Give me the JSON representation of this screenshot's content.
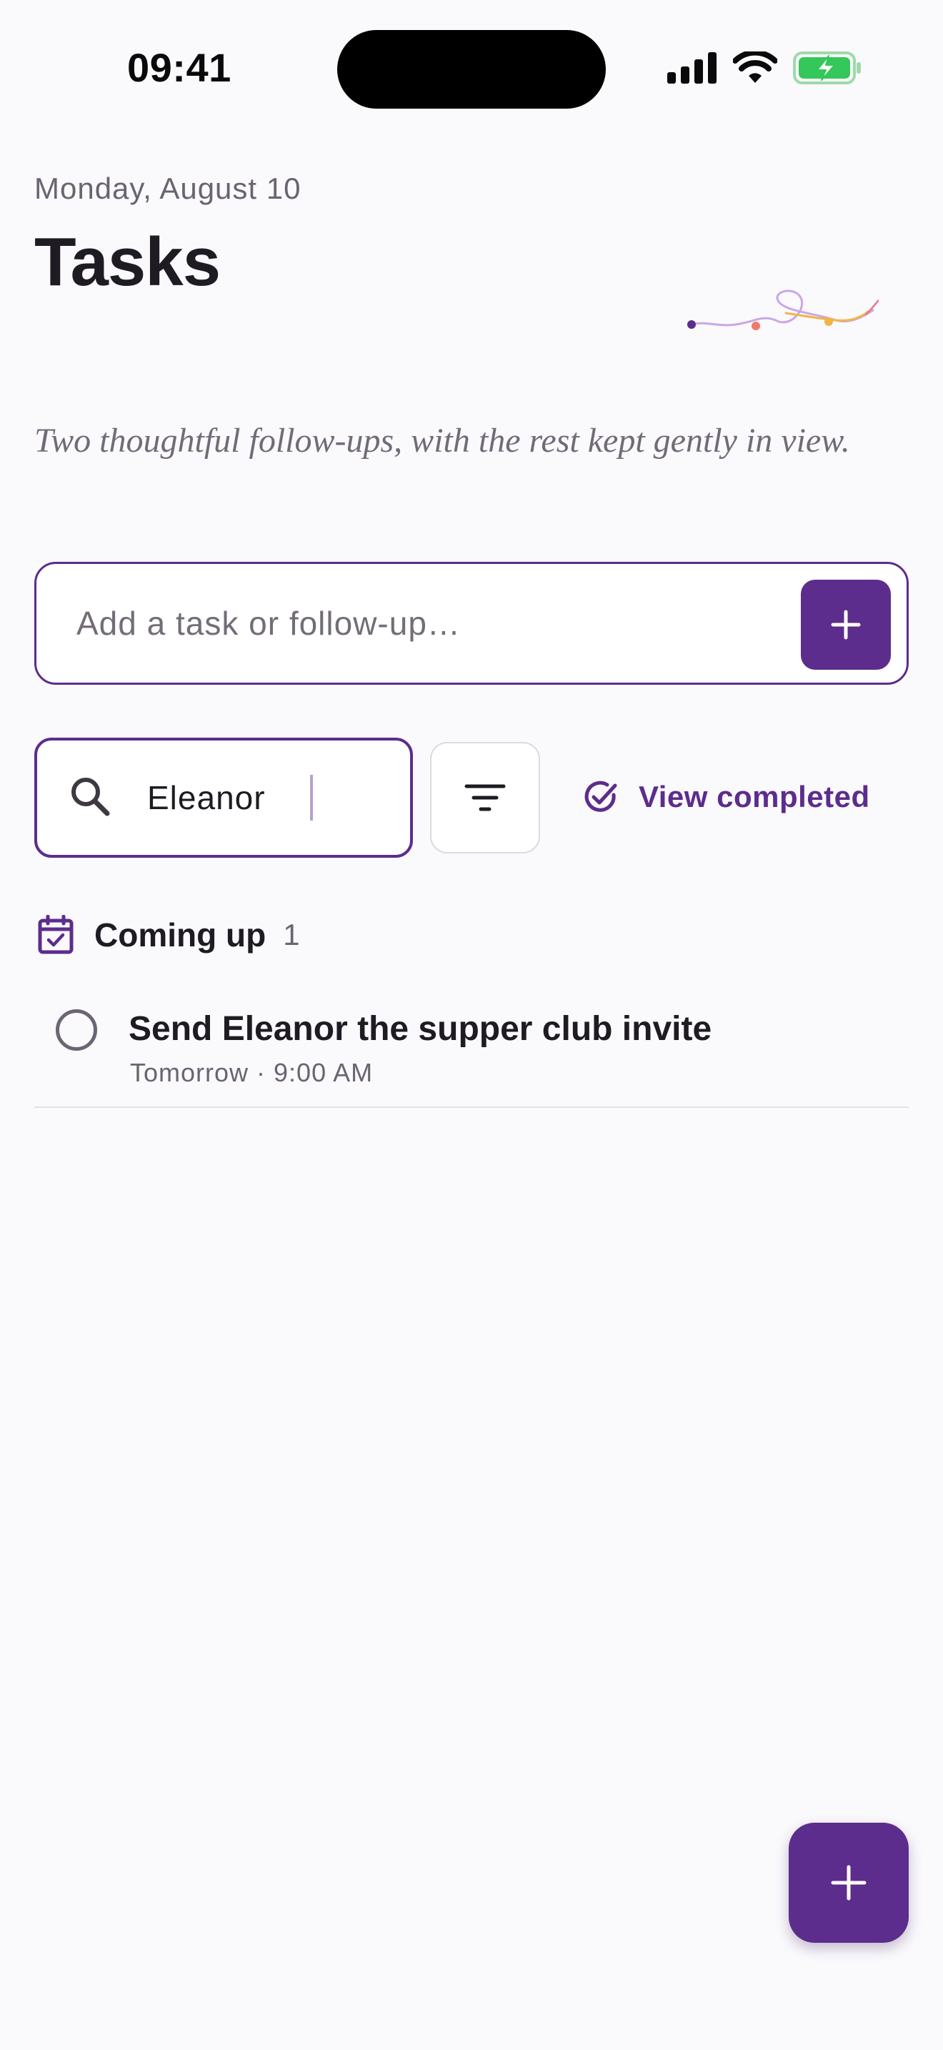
{
  "status_bar": {
    "time": "09:41"
  },
  "header": {
    "date": "Monday, August 10",
    "title": "Tasks",
    "subtitle": "Two thoughtful follow-ups, with the rest kept gently in view."
  },
  "add_task": {
    "placeholder": "Add a task or follow-up…",
    "button_icon": "plus-icon"
  },
  "search": {
    "value": "Eleanor",
    "icon": "search-icon"
  },
  "filter": {
    "icon": "filter-icon"
  },
  "view_completed": {
    "label": "View completed",
    "icon": "check-circle-icon"
  },
  "section": {
    "icon": "calendar-check-icon",
    "title": "Coming up",
    "count": "1"
  },
  "tasks": [
    {
      "title": "Send Eleanor the supper club invite",
      "meta": "Tomorrow · 9:00 AM",
      "completed": false
    }
  ],
  "fab": {
    "icon": "plus-icon"
  },
  "colors": {
    "accent": "#5c2d8c",
    "background": "#faf9fc",
    "battery": "#34c759"
  }
}
